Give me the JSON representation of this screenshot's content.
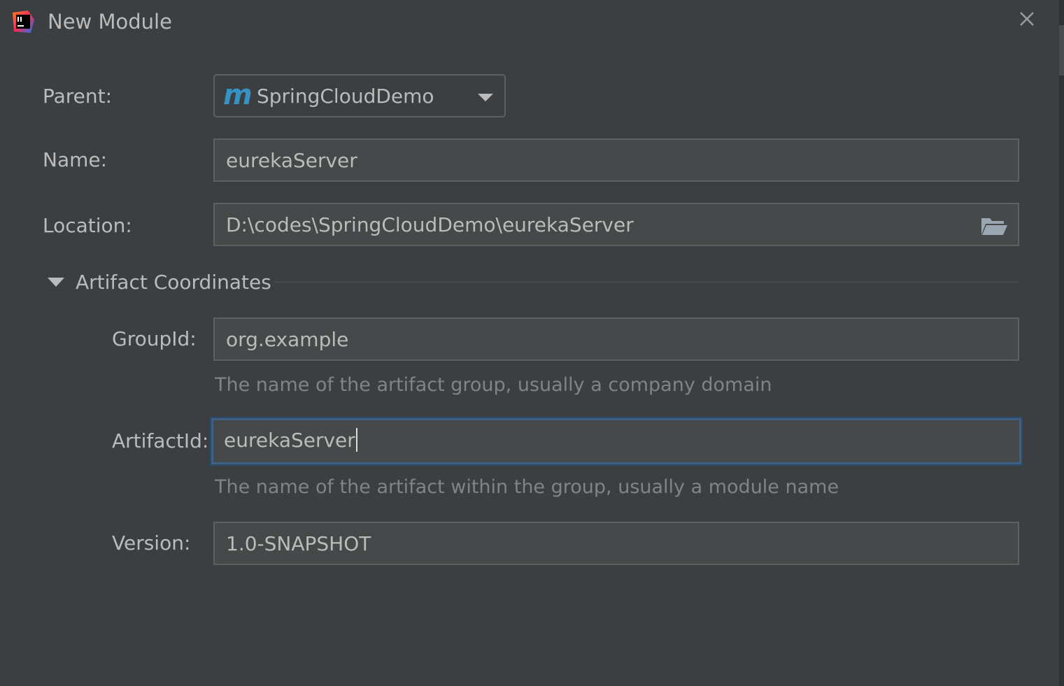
{
  "window": {
    "title": "New Module",
    "app_icon": "intellij-idea-icon",
    "close_icon": "close-icon"
  },
  "form": {
    "parent": {
      "label": "Parent:",
      "value": "SpringCloudDemo",
      "icon": "maven-m-icon"
    },
    "name": {
      "label": "Name:",
      "value": "eurekaServer"
    },
    "location": {
      "label": "Location:",
      "value": "D:\\codes\\SpringCloudDemo\\eurekaServer",
      "icon": "folder-open-icon"
    }
  },
  "artifact_coordinates": {
    "title": "Artifact Coordinates",
    "expanded": true,
    "group_id": {
      "label": "GroupId:",
      "value": "org.example",
      "hint": "The name of the artifact group, usually a company domain"
    },
    "artifact_id": {
      "label": "ArtifactId:",
      "value": "eurekaServer",
      "hint": "The name of the artifact within the group, usually a module name",
      "focused": true
    },
    "version": {
      "label": "Version:",
      "value": "1.0-SNAPSHOT"
    }
  },
  "colors": {
    "background": "#3c3f41",
    "field_background": "#45494a",
    "field_border": "#5e6060",
    "focus_border": "#3d6185",
    "text": "#bbbbbb",
    "hint_text": "#808486",
    "maven_accent": "#3592c4"
  }
}
